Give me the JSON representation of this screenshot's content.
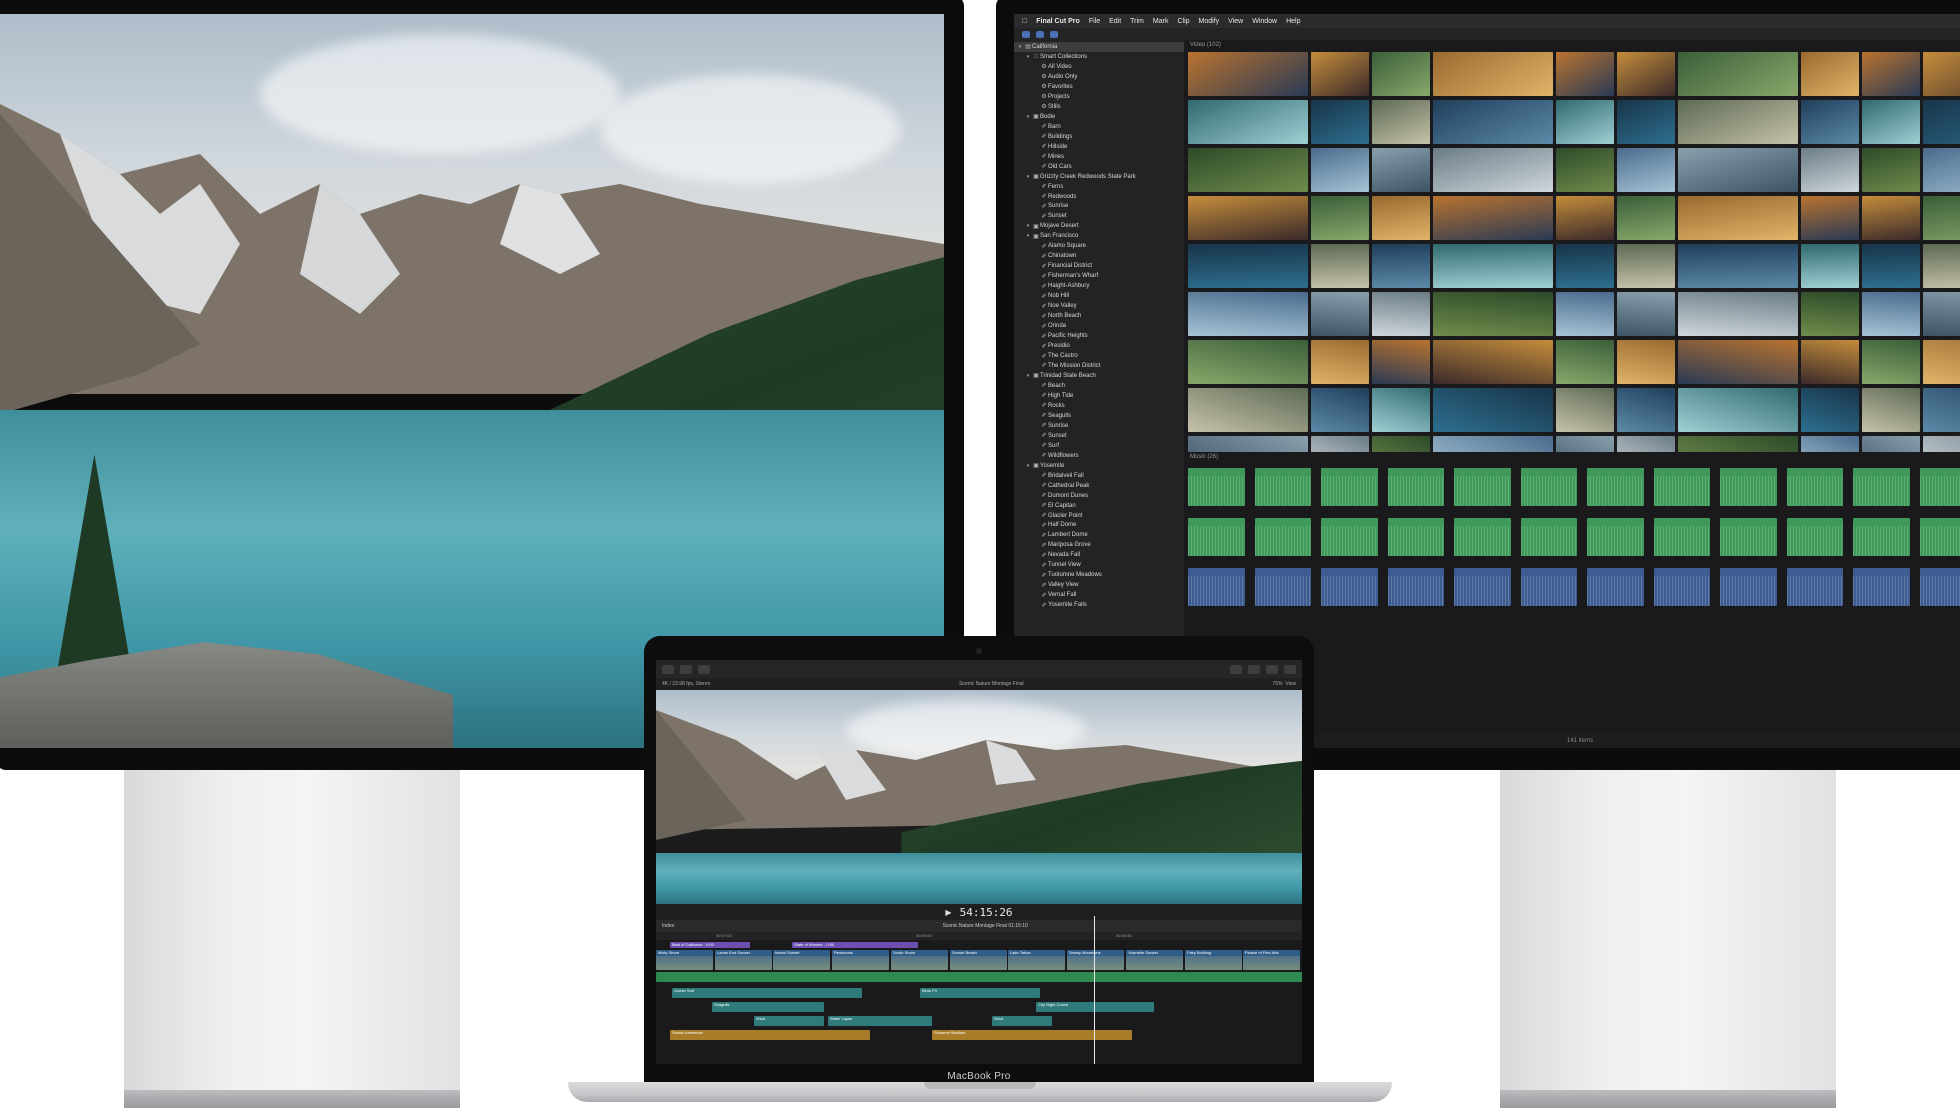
{
  "fcp": {
    "menu": [
      "Final Cut Pro",
      "File",
      "Edit",
      "Trim",
      "Mark",
      "Clip",
      "Modify",
      "View",
      "Window",
      "Help"
    ],
    "library": [
      {
        "label": "California",
        "level": 0,
        "type": "library",
        "selected": true
      },
      {
        "label": "Smart Collections",
        "level": 1,
        "type": "folder"
      },
      {
        "label": "All Video",
        "level": 2,
        "type": "smart"
      },
      {
        "label": "Audio Only",
        "level": 2,
        "type": "smart"
      },
      {
        "label": "Favorites",
        "level": 2,
        "type": "smart"
      },
      {
        "label": "Projects",
        "level": 2,
        "type": "smart"
      },
      {
        "label": "Stills",
        "level": 2,
        "type": "smart"
      },
      {
        "label": "Bodie",
        "level": 1,
        "type": "event"
      },
      {
        "label": "Barn",
        "level": 2,
        "type": "keyword"
      },
      {
        "label": "Buildings",
        "level": 2,
        "type": "keyword"
      },
      {
        "label": "Hillside",
        "level": 2,
        "type": "keyword"
      },
      {
        "label": "Mines",
        "level": 2,
        "type": "keyword"
      },
      {
        "label": "Old Cars",
        "level": 2,
        "type": "keyword"
      },
      {
        "label": "Grizzly Creek Redwoods State Park",
        "level": 1,
        "type": "event"
      },
      {
        "label": "Ferns",
        "level": 2,
        "type": "keyword"
      },
      {
        "label": "Redwoods",
        "level": 2,
        "type": "keyword"
      },
      {
        "label": "Sunrise",
        "level": 2,
        "type": "keyword"
      },
      {
        "label": "Sunset",
        "level": 2,
        "type": "keyword"
      },
      {
        "label": "Mojave Desert",
        "level": 1,
        "type": "event"
      },
      {
        "label": "San Francisco",
        "level": 1,
        "type": "event"
      },
      {
        "label": "Alamo Square",
        "level": 2,
        "type": "keyword"
      },
      {
        "label": "Chinatown",
        "level": 2,
        "type": "keyword"
      },
      {
        "label": "Financial District",
        "level": 2,
        "type": "keyword"
      },
      {
        "label": "Fisherman's Wharf",
        "level": 2,
        "type": "keyword"
      },
      {
        "label": "Haight-Ashbury",
        "level": 2,
        "type": "keyword"
      },
      {
        "label": "Nob Hill",
        "level": 2,
        "type": "keyword"
      },
      {
        "label": "Noe Valley",
        "level": 2,
        "type": "keyword"
      },
      {
        "label": "North Beach",
        "level": 2,
        "type": "keyword"
      },
      {
        "label": "Orinda",
        "level": 2,
        "type": "keyword"
      },
      {
        "label": "Pacific Heights",
        "level": 2,
        "type": "keyword"
      },
      {
        "label": "Presidio",
        "level": 2,
        "type": "keyword"
      },
      {
        "label": "The Castro",
        "level": 2,
        "type": "keyword"
      },
      {
        "label": "The Mission District",
        "level": 2,
        "type": "keyword"
      },
      {
        "label": "Trinidad State Beach",
        "level": 1,
        "type": "event"
      },
      {
        "label": "Beach",
        "level": 2,
        "type": "keyword"
      },
      {
        "label": "High Tide",
        "level": 2,
        "type": "keyword"
      },
      {
        "label": "Rocks",
        "level": 2,
        "type": "keyword"
      },
      {
        "label": "Seagulls",
        "level": 2,
        "type": "keyword"
      },
      {
        "label": "Sunrise",
        "level": 2,
        "type": "keyword"
      },
      {
        "label": "Sunset",
        "level": 2,
        "type": "keyword"
      },
      {
        "label": "Surf",
        "level": 2,
        "type": "keyword"
      },
      {
        "label": "Wildflowers",
        "level": 2,
        "type": "keyword"
      },
      {
        "label": "Yosemite",
        "level": 1,
        "type": "event"
      },
      {
        "label": "Bridalveil Fall",
        "level": 2,
        "type": "keyword"
      },
      {
        "label": "Cathedral Peak",
        "level": 2,
        "type": "keyword"
      },
      {
        "label": "Dumont Dunes",
        "level": 2,
        "type": "keyword"
      },
      {
        "label": "El Capitan",
        "level": 2,
        "type": "keyword"
      },
      {
        "label": "Glacier Point",
        "level": 2,
        "type": "keyword"
      },
      {
        "label": "Half Dome",
        "level": 2,
        "type": "keyword"
      },
      {
        "label": "Lambert Dome",
        "level": 2,
        "type": "keyword"
      },
      {
        "label": "Mariposa Grove",
        "level": 2,
        "type": "keyword"
      },
      {
        "label": "Nevada Fall",
        "level": 2,
        "type": "keyword"
      },
      {
        "label": "Tunnel View",
        "level": 2,
        "type": "keyword"
      },
      {
        "label": "Tuolumne Meadows",
        "level": 2,
        "type": "keyword"
      },
      {
        "label": "Valley View",
        "level": 2,
        "type": "keyword"
      },
      {
        "label": "Vernal Fall",
        "level": 2,
        "type": "keyword"
      },
      {
        "label": "Yosemite Falls",
        "level": 2,
        "type": "keyword"
      }
    ],
    "video_section": "Video (102)",
    "music_section": "Music (26)",
    "status": "141 items",
    "colors": {
      "audio_green": "#3f9a5a",
      "audio_blue": "#3d5d92",
      "accent_blue": "#4a6fb5"
    }
  },
  "macbook": {
    "label": "MacBook Pro",
    "viewer_left": "4K / 23.98 fps, Stereo",
    "viewer_title": "Scenic Nature Montage Final",
    "zoom": "75%",
    "view_menu": "View",
    "timecode": "54:15:26",
    "index_label": "Index",
    "timeline_title": "Scenic Nature Montage Final",
    "timeline_duration": "01:15:10",
    "ruler": [
      "00:57:03",
      "00:59:00",
      "00:59:30"
    ],
    "titles": [
      "Best of California - 0:00",
      "State of Wonder - 0:00"
    ],
    "primary_clips": [
      "Misty Shore",
      "Lands End Sunset",
      "Inland Sunset",
      "Redwoods",
      "South Shore",
      "Sunset Beach",
      "Lake Tahoe",
      "Snowy Mountains",
      "Yosemite Sunset",
      "Fairy Building",
      "Palace of Fine Arts"
    ],
    "audio_clips": [
      {
        "label": "Ocean Surf",
        "lane": 0
      },
      {
        "label": "Birds FX",
        "lane": 0
      },
      {
        "label": "Seagulls",
        "lane": 1
      },
      {
        "label": "City Night Crowd",
        "lane": 1
      },
      {
        "label": "Wind",
        "lane": 2
      },
      {
        "label": "Water Lapse",
        "lane": 2
      },
      {
        "label": "Wind",
        "lane": 2
      },
      {
        "label": "Scenic Ambience",
        "lane": 3
      },
      {
        "label": "Shimmer Medium",
        "lane": 3
      }
    ]
  }
}
